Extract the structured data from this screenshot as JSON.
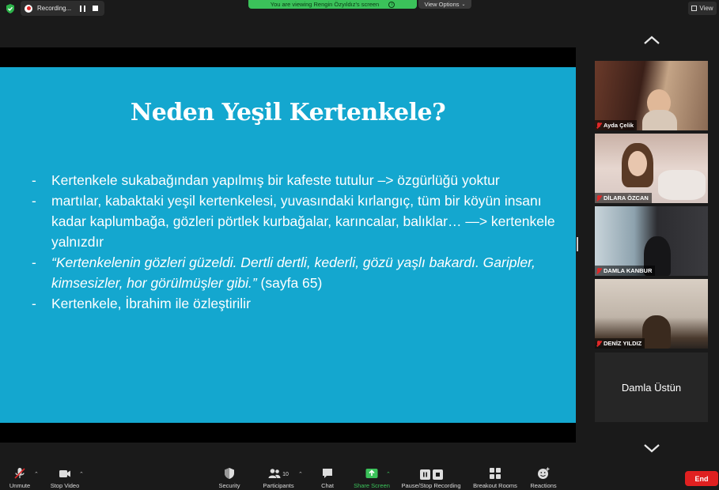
{
  "topbar": {
    "recording_label": "Recording...",
    "viewing_banner": "You are viewing Rengin Özyıldız's screen",
    "view_options": "View Options",
    "view_button": "View"
  },
  "slide": {
    "title": "Neden Yeşil Kertenkele?",
    "bullets": [
      {
        "dash": "-",
        "text": "Kertenkele sukabağından yapılmış bir kafeste tutulur –> özgürlüğü yoktur"
      },
      {
        "dash": "-",
        "text": "martılar, kabaktaki yeşil kertenkelesi, yuvasındaki kırlangıç, tüm bir köyün insanı kadar kaplumbağa, gözleri pörtlek kurbağalar, karıncalar, balıklar… —> kertenkele yalnızdır"
      },
      {
        "dash": "-",
        "italic": "“Kertenkelenin gözleri güzeldi. Dertli dertli, kederli, gözü yaşlı bakardı. Garipler, kimsesizler, hor görülmüşler gibi.”",
        "text": " (sayfa 65)"
      },
      {
        "dash": "-",
        "text": "Kertenkele, İbrahim ile özleştirilir"
      }
    ]
  },
  "participants": [
    {
      "name": "Ayda Çelik"
    },
    {
      "name": "DİLARA ÖZCAN"
    },
    {
      "name": "DAMLA KANBUR"
    },
    {
      "name": "DENİZ YILDIZ"
    },
    {
      "name": "Damla Üstün"
    }
  ],
  "toolbar": {
    "unmute": "Unmute",
    "stop_video": "Stop Video",
    "security": "Security",
    "participants": "Participants",
    "participants_count": "10",
    "chat": "Chat",
    "share_screen": "Share Screen",
    "pause_stop_recording": "Pause/Stop Recording",
    "breakout_rooms": "Breakout Rooms",
    "reactions": "Reactions",
    "end": "End"
  },
  "colors": {
    "slide_bg": "#14a7cf",
    "share_green": "#3bc25a",
    "end_red": "#e02020"
  }
}
